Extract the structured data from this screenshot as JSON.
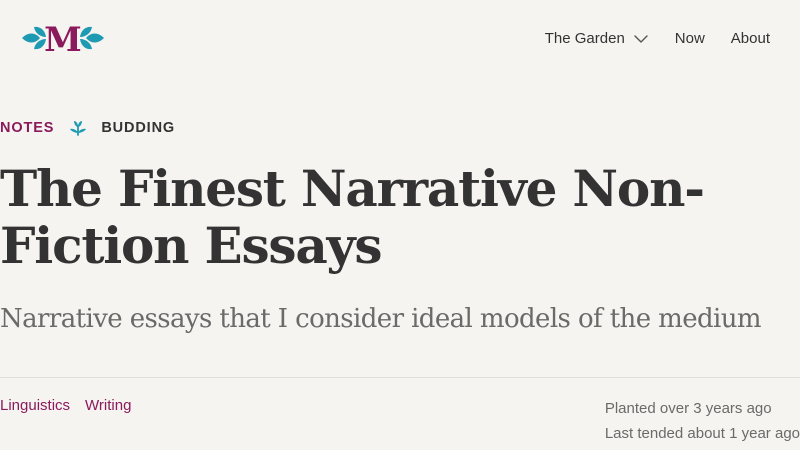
{
  "header": {
    "logo_letter": "M",
    "nav": [
      {
        "label": "The Garden",
        "has_dropdown": true
      },
      {
        "label": "Now"
      },
      {
        "label": "About"
      }
    ]
  },
  "post": {
    "category": "NOTES",
    "growth_icon": "sprout-icon",
    "stage": "BUDDING",
    "title_line1": "The Finest Narrative Non-",
    "title_line2": "Fiction Essays",
    "subtitle": "Narrative essays that I consider ideal models of the medium",
    "topics": [
      "Linguistics",
      "Writing"
    ],
    "planted": "Planted over 3 years ago",
    "tended": "Last tended about 1 year ago"
  },
  "colors": {
    "brand": "#8b1a5c",
    "accent": "#1e9ab3",
    "background": "#f6f4f1",
    "text": "#333333",
    "muted": "#6a6a6a"
  }
}
